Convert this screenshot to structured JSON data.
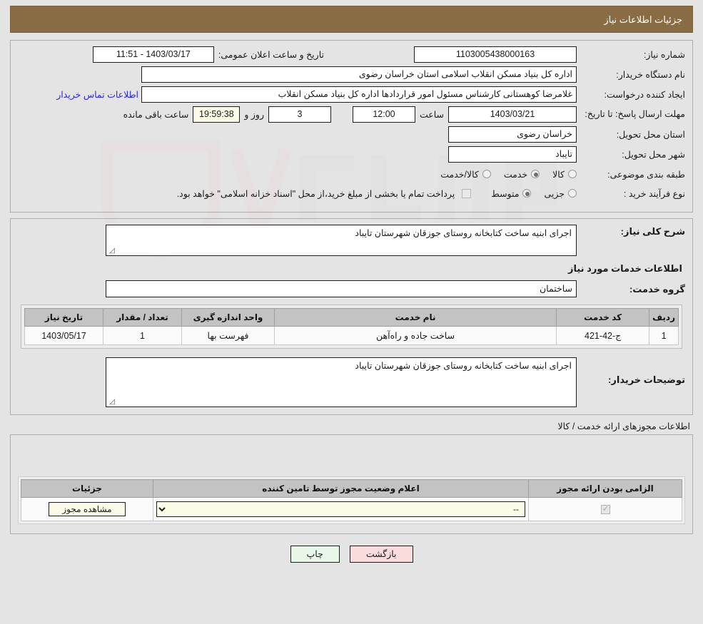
{
  "header": {
    "title": "جزئیات اطلاعات نیاز"
  },
  "form": {
    "need_number_label": "شماره نیاز:",
    "need_number_value": "1103005438000163",
    "announce_label": "تاریخ و ساعت اعلان عمومی:",
    "announce_value": "1403/03/17 - 11:51",
    "buyer_org_label": "نام دستگاه خریدار:",
    "buyer_org_value": "اداره کل بنیاد مسکن انقلاب اسلامی استان خراسان رضوی",
    "creator_label": "ایجاد کننده درخواست:",
    "creator_value": "غلامرضا کوهستانی کارشناس مسئول امور قراردادها اداره کل بنیاد مسکن انقلاب",
    "contact_link": "اطلاعات تماس خریدار",
    "deadline_label": "مهلت ارسال پاسخ: تا تاریخ:",
    "deadline_date": "1403/03/21",
    "hour_label": "ساعت",
    "deadline_time": "12:00",
    "days_value": "3",
    "days_label": "روز و",
    "remaining_time": "19:59:38",
    "remaining_label": "ساعت باقی مانده",
    "province_label": "استان محل تحویل:",
    "province_value": "خراسان رضوی",
    "city_label": "شهر محل تحویل:",
    "city_value": "تایباد",
    "category_label": "طبقه بندی موضوعی:",
    "category_options": [
      "کالا",
      "خدمت",
      "کالا/خدمت"
    ],
    "category_selected": "خدمت",
    "process_label": "نوع فرآیند خرید :",
    "process_options": [
      "جزیی",
      "متوسط"
    ],
    "process_selected": "متوسط",
    "treasury_note": "پرداخت تمام یا بخشی از مبلغ خرید،از محل \"اسناد خزانه اسلامی\" خواهد بود."
  },
  "description": {
    "general_label": "شرح کلی نیاز:",
    "general_value": "اجرای ابنیه ساخت کتابخانه روستای جوزقان شهرستان تایباد",
    "services_heading": "اطلاعات خدمات مورد نیاز",
    "service_group_label": "گروه خدمت:",
    "service_group_value": "ساختمان"
  },
  "services_table": {
    "columns": [
      "ردیف",
      "کد خدمت",
      "نام خدمت",
      "واحد اندازه گیری",
      "تعداد / مقدار",
      "تاریخ نیاز"
    ],
    "rows": [
      {
        "row_no": "1",
        "code": "ج-42-421",
        "name": "ساخت جاده و راه‌آهن",
        "unit": "فهرست بها",
        "qty": "1",
        "need_date": "1403/05/17"
      }
    ]
  },
  "buyer_notes": {
    "label": "توضیحات خریدار:",
    "value": "اجرای ابنیه ساخت کتابخانه روستای جوزقان شهرستان تایباد"
  },
  "permits": {
    "caption": "اطلاعات مجوزهای ارائه خدمت / کالا",
    "columns": [
      "الزامی بودن ارائه مجوز",
      "اعلام وضعیت مجوز توسط تامین کننده",
      "جزئیات"
    ],
    "rows": [
      {
        "required_checked": true,
        "status_selected": "--",
        "status_options": [
          "--"
        ],
        "details_button": "مشاهده مجوز"
      }
    ]
  },
  "footer": {
    "print_label": "چاپ",
    "back_label": "بازگشت"
  },
  "colors": {
    "header_bg": "#8a6c44",
    "page_bg": "#e4e4e4",
    "link": "#2828dd",
    "print_btn": "#e9f7e9",
    "back_btn": "#fadcdc",
    "field_highlight": "#fbfbe8"
  }
}
